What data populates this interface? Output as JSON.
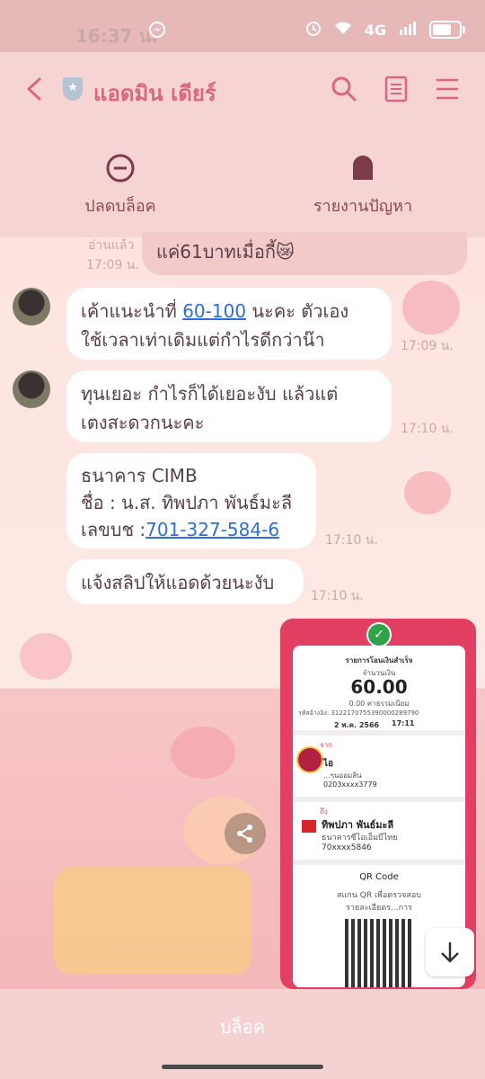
{
  "status_bar": {
    "time": "16:37 น.",
    "network": "4G"
  },
  "header": {
    "back_icon": "back-arrow-icon",
    "shield_icon": "shield-icon",
    "title": "แอดมิน เดียร์",
    "search_icon": "search-icon",
    "notes_icon": "notes-icon",
    "menu_icon": "menu-icon"
  },
  "actions": [
    {
      "label": "ปลดบล็อค",
      "icon": "unblock-icon"
    },
    {
      "label": "รายงานปัญหา",
      "icon": "report-icon"
    }
  ],
  "chat": {
    "top_mine": {
      "read": "อ่านแล้ว",
      "time": "17:09 น.",
      "text": "แค่61บาทเมื่อกี้😿"
    },
    "messages": [
      {
        "text_a": "เค้าแนะนำที่ ",
        "link": "60-100",
        "text_b": " นะคะ ตัวเอง",
        "text_c": "ใช้เวลาเท่าเดิมแต่กำไรดีกว่าน๊า",
        "time": "17:09 น."
      },
      {
        "text": "ทุนเยอะ กำไรก็ได้เยอะงับ แล้วแต่",
        "text2": "เตงสะดวกนะคะ",
        "time": "17:10 น."
      },
      {
        "line1": "ธนาคาร  CIMB",
        "line2": "ชื่อ : น.ส. ทิพปภา พันธ์มะลี",
        "line3_label": "เลขบช :",
        "line3_link": "701-327-584-6",
        "time": "17:10 น."
      },
      {
        "text": "แจ้งสลิปให้แอดด้วยนะงับ",
        "time": "17:10 น."
      }
    ]
  },
  "slip": {
    "title": "รายการโอนเงินสำเร็จ",
    "amount_label": "จำนวนเงิน",
    "amount": "60.00",
    "fee": "0.00 ค่าธรรมเนียม",
    "ref": "รหัสอ้างอิง: 3122170755390000289790",
    "date": "2 พ.ค. 2566",
    "clock": "17:11",
    "from_label": "จาก",
    "from_name": "ไอ",
    "from_type": "...ๆนออมสิน",
    "from_acct": "0203xxxx3779",
    "to_label": "ถึง",
    "to_name": "ทิพปภา พันธ์มะลี",
    "to_bank": "ธนาคารซีไอเอ็มบีไทย",
    "to_acct": "70xxxx5846",
    "qr_title": "QR Code",
    "qr_text1": "สแกน QR เพื่อตรวจสอบ",
    "qr_text2": "รายละเอียดร...การ"
  },
  "bottom": {
    "block_label": "บล็อค"
  }
}
